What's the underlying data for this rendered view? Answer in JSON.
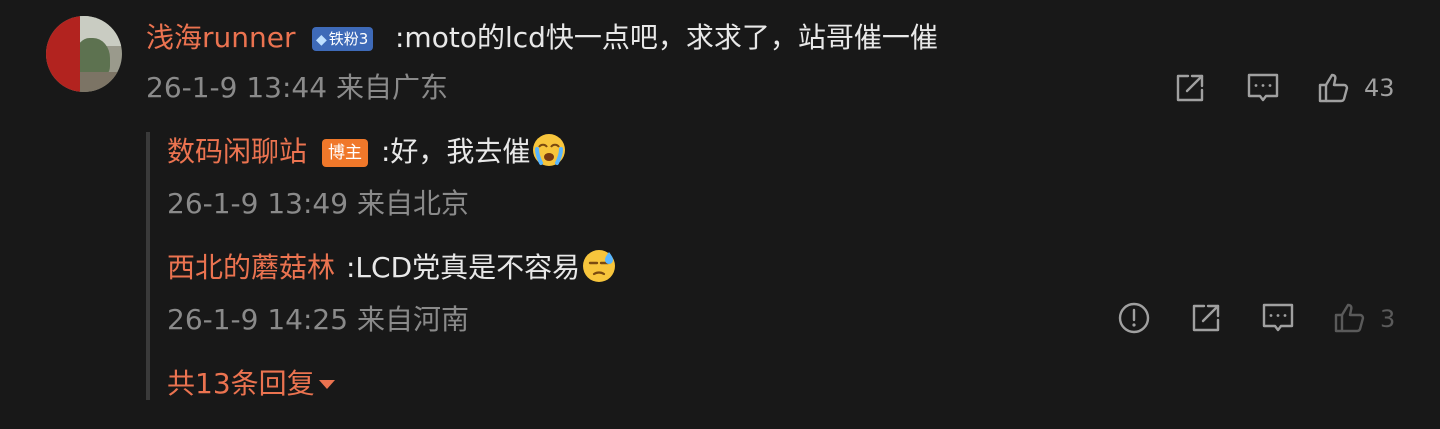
{
  "main_comment": {
    "username": "浅海runner",
    "badge": "铁粉3",
    "text": ":moto的lcd快一点吧，求求了，站哥催一催",
    "meta": "26-1-9 13:44 来自广东",
    "likes": "43"
  },
  "replies": [
    {
      "username": "数码闲聊站",
      "badge": "博主",
      "text": ":好，我去催",
      "emoji": "crying-face-emoji",
      "meta": "26-1-9 13:49 来自北京"
    },
    {
      "username": "西北的蘑菇林",
      "text": ":LCD党真是不容易",
      "emoji": "sweat-face-emoji",
      "meta": "26-1-9 14:25 来自河南",
      "likes": "3"
    }
  ],
  "more_replies": "共13条回复",
  "colors": {
    "background": "#181818",
    "username": "#eb7350",
    "text": "#e8e8e8",
    "meta": "#8a8a8a",
    "fan_badge": "#3e6ab8",
    "host_badge": "#f0782a"
  },
  "icons": {
    "main_actions": [
      "share-icon",
      "comment-icon",
      "like-icon"
    ],
    "reply_actions": [
      "report-icon",
      "share-icon",
      "comment-icon",
      "like-icon"
    ]
  }
}
